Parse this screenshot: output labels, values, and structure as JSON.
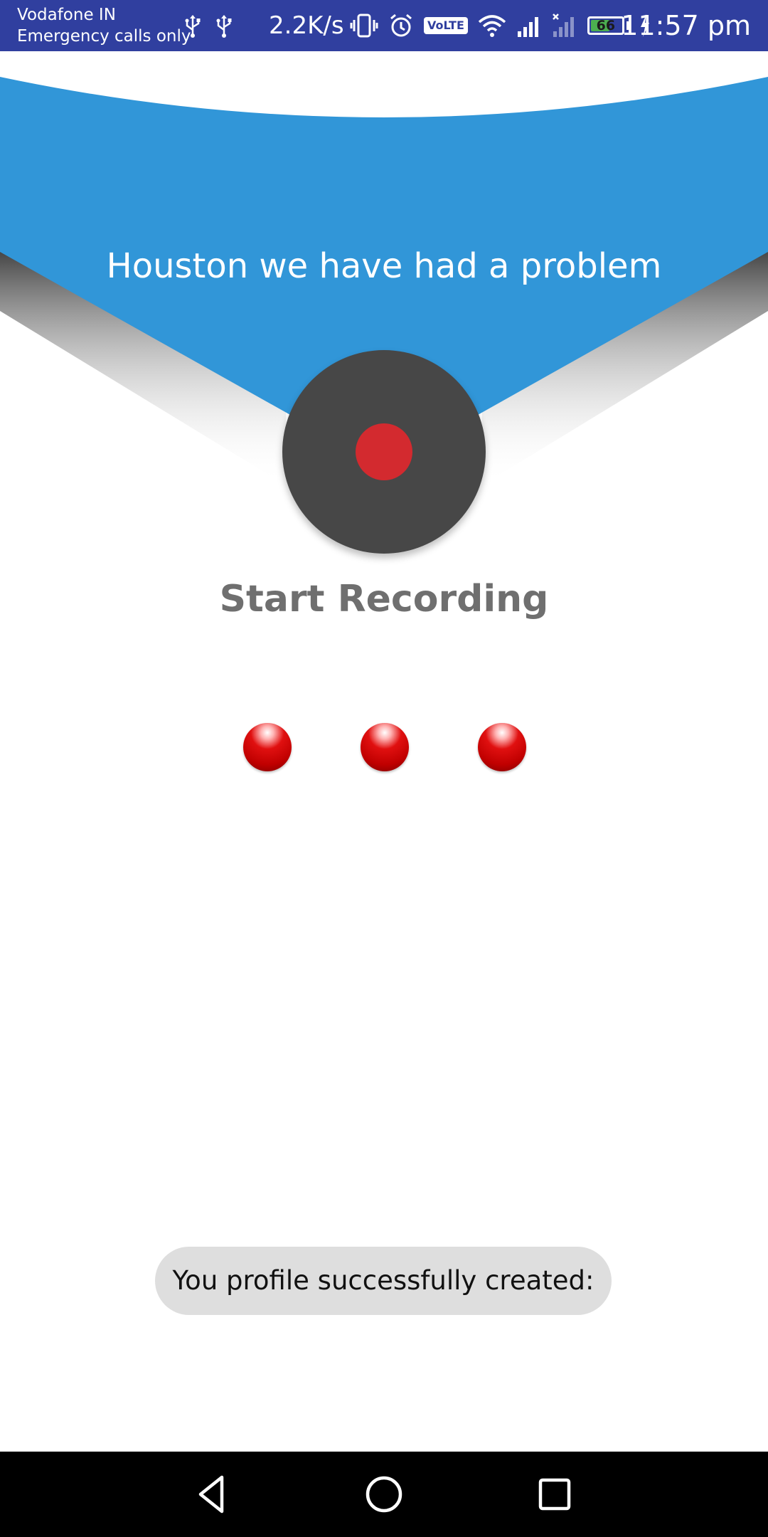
{
  "status_bar": {
    "carrier": "Vodafone IN",
    "subtext": "Emergency calls only",
    "net_speed": "2.2K/s",
    "volte_label": "VoLTE",
    "battery_level": "66",
    "battery_fraction": 0.66,
    "battery_color": "#4caf50",
    "clock": "11:57 pm",
    "icons": [
      "usb-icon",
      "usb-icon",
      "vibrate-icon",
      "alarm-icon",
      "volte-icon",
      "wifi-icon",
      "signal-icon",
      "no-signal-icon",
      "battery-icon",
      "charging-icon"
    ],
    "background": "#303f9f"
  },
  "banner": {
    "title": "Houston we have had a problem",
    "color": "#3196d8"
  },
  "record": {
    "label": "Start Recording",
    "button_color": "#474747",
    "dot_color": "#d32a2f"
  },
  "indicators": {
    "count": 3,
    "color": "#e01010"
  },
  "toast": {
    "message": "You profile successfully created:"
  },
  "nav_bar": {
    "icons": [
      "back-icon",
      "home-icon",
      "recents-icon"
    ]
  }
}
